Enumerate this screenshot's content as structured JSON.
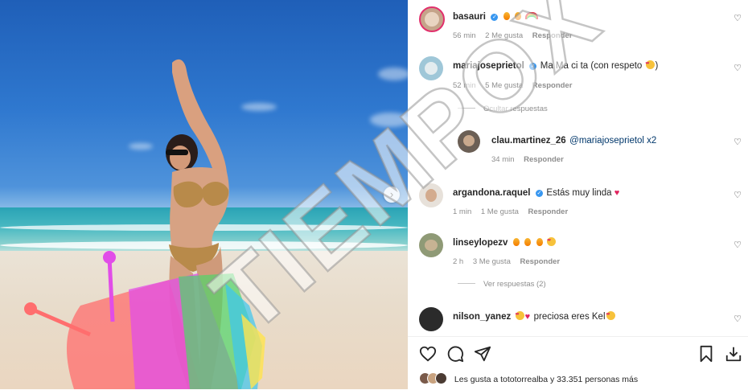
{
  "post": {
    "comments": [
      {
        "user": "basauri",
        "verified": true,
        "text": "",
        "emojis": [
          "flame-emoji",
          "flame-emoji",
          "rainbow-emoji"
        ],
        "time": "56 min",
        "likes": "2 Me gusta",
        "reply": "Responder"
      },
      {
        "user": "mariajoseprietol",
        "verified": true,
        "text": "Ma Ma ci ta (con respeto ",
        "text_end": ")",
        "emojis": [
          "heart-eyes-emoji"
        ],
        "time": "52 min",
        "likes": "5 Me gusta",
        "reply": "Responder",
        "toggle": "Ocultar respuestas",
        "replies": [
          {
            "user": "clau.martinez_26",
            "text": "@mariajoseprietol x2",
            "time": "34 min",
            "reply": "Responder"
          }
        ]
      },
      {
        "user": "argandona.raquel",
        "verified": true,
        "text": "Estás muy linda ",
        "emojis": [
          "red-heart-emoji"
        ],
        "time": "1 min",
        "likes": "1 Me gusta",
        "reply": "Responder"
      },
      {
        "user": "linseylopezv",
        "verified": false,
        "text": "",
        "emojis": [
          "flame-emoji",
          "flame-emoji",
          "flame-emoji",
          "heart-eyes-emoji"
        ],
        "time": "2 h",
        "likes": "3 Me gusta",
        "reply": "Responder",
        "toggle": "Ver respuestas (2)"
      },
      {
        "user": "nilson_yanez",
        "verified": false,
        "text": "preciosa eres Kel",
        "emojis": [
          "heart-eyes-emoji",
          "red-heart-emoji"
        ]
      }
    ],
    "likes_text": "Les gusta a tototorrealba y 33.351 personas más"
  },
  "watermark": "TIEMPOX",
  "colors": {
    "verified": "#3897f0",
    "heart": "#e0245e",
    "muted": "#8e8e8e",
    "sky": "#2f78cf",
    "sand": "#e8dccb"
  },
  "icons": [
    "heart-icon",
    "comment-icon",
    "share-icon",
    "bookmark-icon",
    "download-icon",
    "next-arrow-icon"
  ]
}
